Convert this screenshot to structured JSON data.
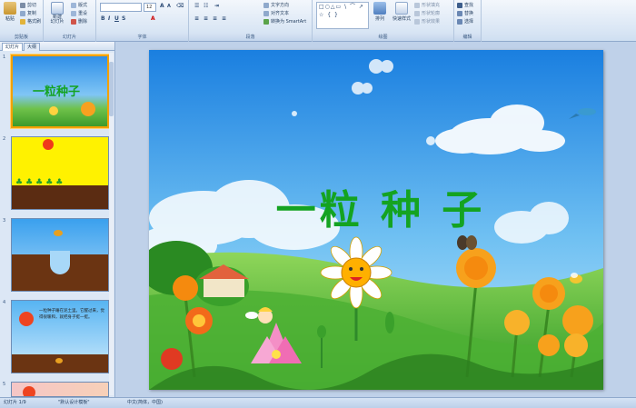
{
  "ribbon": {
    "clipboard": {
      "label": "剪贴板",
      "paste": "粘贴",
      "cut": "剪切",
      "copy": "复制",
      "painter": "格式刷"
    },
    "slides": {
      "label": "幻灯片",
      "new_slide": "新建\n幻灯片",
      "layout": "版式",
      "reset": "重设",
      "delete": "删除"
    },
    "font": {
      "label": "字体",
      "font_name": "",
      "font_size": "12"
    },
    "paragraph": {
      "label": "段落",
      "text_direction": "文字方向",
      "align_text": "对齐文本",
      "smartart": "转换为 SmartArt"
    },
    "drawing": {
      "label": "绘图",
      "shapes": "□○△▭ \\ ⌒ ↗ ☆ { }",
      "arrange": "排列",
      "quick_styles": "快速样式",
      "fill": "形状填充",
      "outline": "形状轮廓",
      "effects": "形状效果"
    },
    "editing": {
      "label": "编辑",
      "find": "查找",
      "replace": "替换",
      "select": "选择"
    }
  },
  "panel": {
    "tab_slides": "幻灯片",
    "tab_outline": "大纲",
    "thumbs": [
      {
        "num": "1",
        "title": "一粒种子"
      },
      {
        "num": "2"
      },
      {
        "num": "3"
      },
      {
        "num": "4",
        "text": "一粒种子睡在泥土里。它醒过来，觉得很暖和，就把身子挺一挺。"
      },
      {
        "num": "5"
      }
    ]
  },
  "slide": {
    "title": "一粒 种 子",
    "title_color": "#14a321"
  },
  "status": {
    "slide_info": "幻灯片 1/9",
    "theme": "\"默认设计模板\"",
    "language": "中文(简体，中国)"
  },
  "colors": {
    "accent": "#14a321",
    "sky": "#1e8ee6",
    "ribbon": "#dbe7f5"
  }
}
